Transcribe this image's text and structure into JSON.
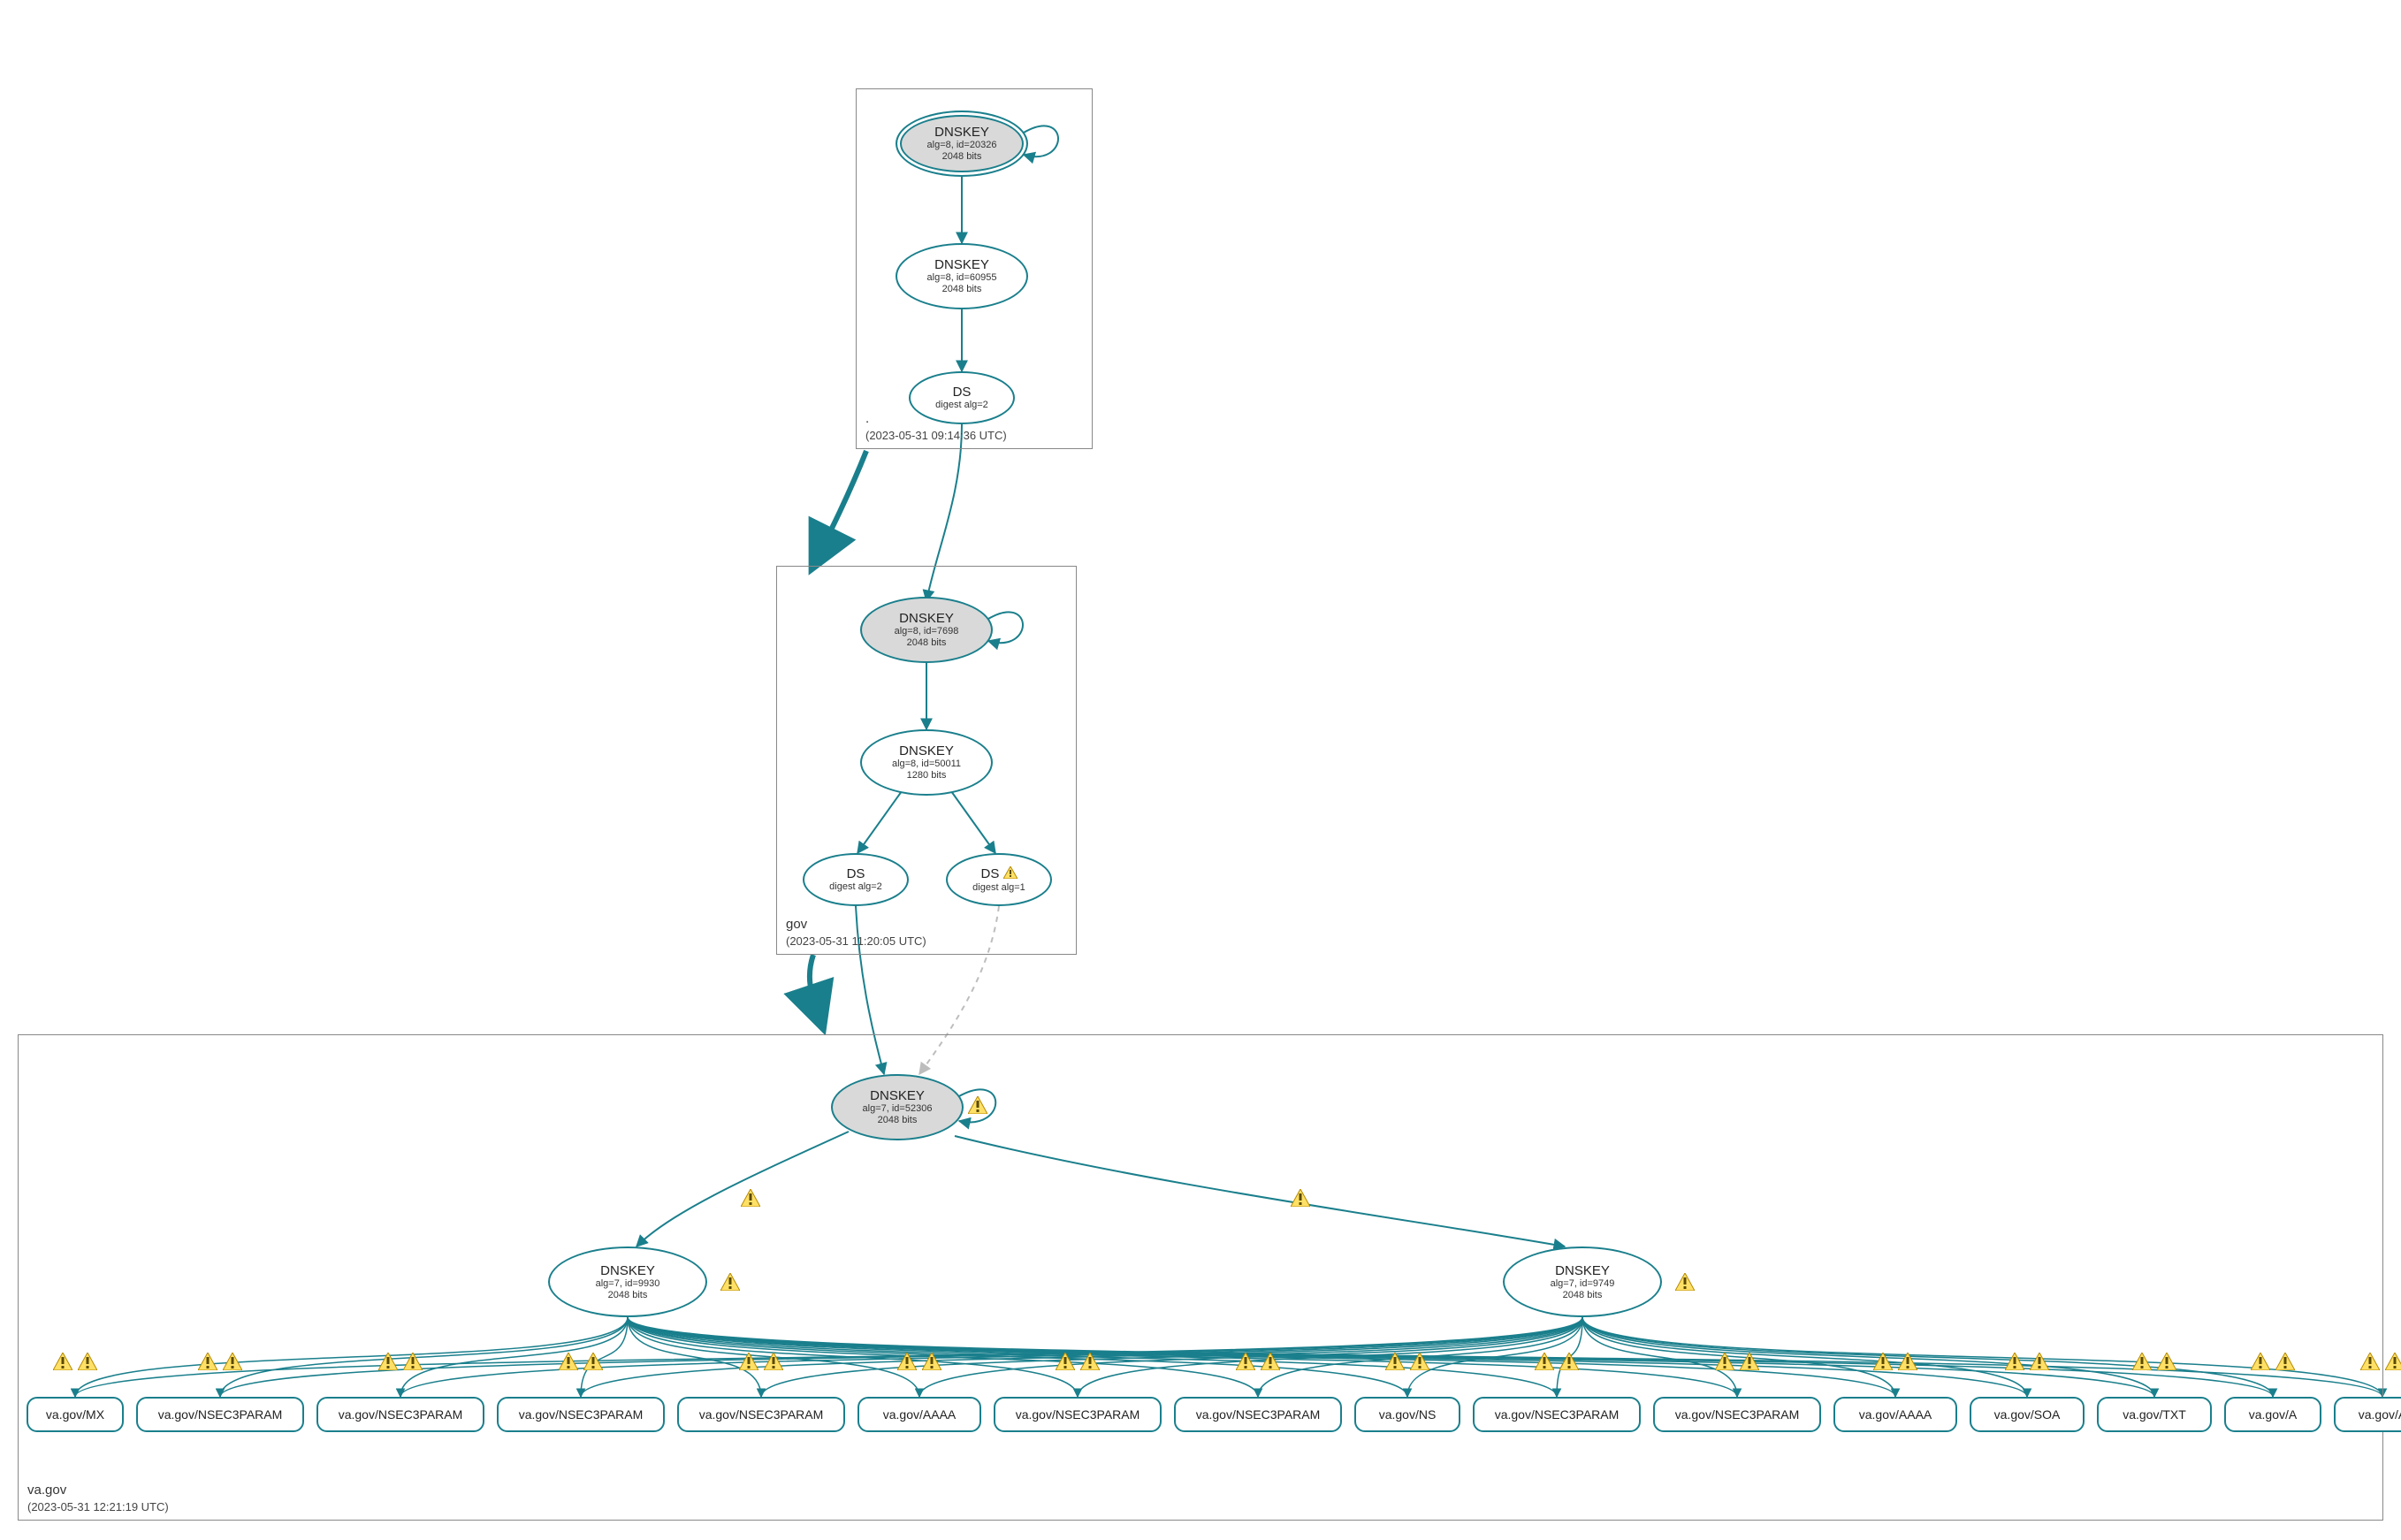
{
  "colors": {
    "stroke": "#1a7f8c",
    "faded": "#bdbdbd",
    "warnFill": "#ffe066",
    "warnStroke": "#b58900"
  },
  "zones": {
    "root": {
      "name": ".",
      "timestamp": "(2023-05-31 09:14:36 UTC)"
    },
    "gov": {
      "name": "gov",
      "timestamp": "(2023-05-31 11:20:05 UTC)"
    },
    "vagov": {
      "name": "va.gov",
      "timestamp": "(2023-05-31 12:21:19 UTC)"
    }
  },
  "nodes": {
    "root_ksk": {
      "title": "DNSKEY",
      "line2": "alg=8, id=20326",
      "line3": "2048 bits"
    },
    "root_zsk": {
      "title": "DNSKEY",
      "line2": "alg=8, id=60955",
      "line3": "2048 bits"
    },
    "root_ds": {
      "title": "DS",
      "line2": "digest alg=2"
    },
    "gov_ksk": {
      "title": "DNSKEY",
      "line2": "alg=8, id=7698",
      "line3": "2048 bits"
    },
    "gov_zsk": {
      "title": "DNSKEY",
      "line2": "alg=8, id=50011",
      "line3": "1280 bits"
    },
    "gov_ds2": {
      "title": "DS",
      "line2": "digest alg=2"
    },
    "gov_ds1": {
      "title": "DS",
      "line2": "digest alg=1"
    },
    "va_ksk": {
      "title": "DNSKEY",
      "line2": "alg=7, id=52306",
      "line3": "2048 bits"
    },
    "va_zsk1": {
      "title": "DNSKEY",
      "line2": "alg=7, id=9930",
      "line3": "2048 bits"
    },
    "va_zsk2": {
      "title": "DNSKEY",
      "line2": "alg=7, id=9749",
      "line3": "2048 bits"
    }
  },
  "rrsets": [
    "va.gov/MX",
    "va.gov/NSEC3PARAM",
    "va.gov/NSEC3PARAM",
    "va.gov/NSEC3PARAM",
    "va.gov/NSEC3PARAM",
    "va.gov/AAAA",
    "va.gov/NSEC3PARAM",
    "va.gov/NSEC3PARAM",
    "va.gov/NS",
    "va.gov/NSEC3PARAM",
    "va.gov/NSEC3PARAM",
    "va.gov/AAAA",
    "va.gov/SOA",
    "va.gov/TXT",
    "va.gov/A",
    "va.gov/A"
  ]
}
